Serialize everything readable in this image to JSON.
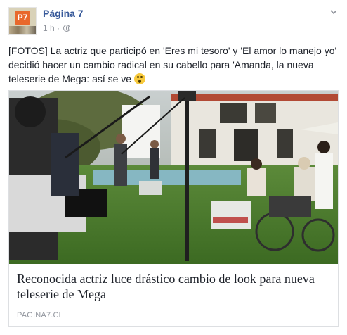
{
  "post": {
    "page_name": "Página 7",
    "time": "1 h",
    "meta_separator": " · ",
    "avatar_label": "P7",
    "text": "[FOTOS] La actriz que participó en 'Eres mi tesoro' y 'El amor lo manejo yo' decidió hacer un cambio radical en su cabello para 'Amanda, la nueva teleserie de Mega: así se ve",
    "emoji": "surprised-face"
  },
  "link_preview": {
    "title": "Reconocida actriz luce drástico cambio de look para nueva teleserie de Mega",
    "domain": "PAGINA7.CL"
  },
  "colors": {
    "page_name": "#365899",
    "meta": "#90949c",
    "text": "#1d2129",
    "border": "#dddfe2",
    "avatar_logo": "#e8682c"
  }
}
